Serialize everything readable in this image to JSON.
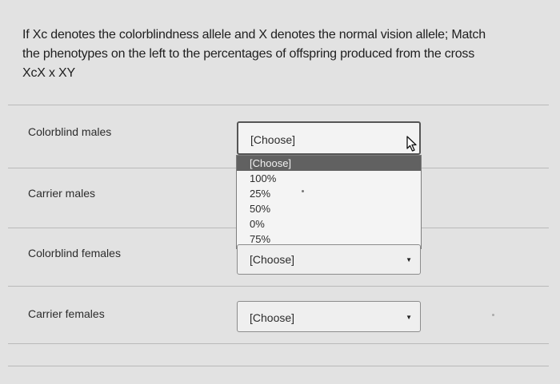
{
  "question": {
    "lines": [
      "If Xc denotes the colorblindness allele and X denotes the normal vision allele; Match",
      "the phenotypes on the left to the percentages of offspring produced from the cross",
      "XcX x XY"
    ]
  },
  "rows": [
    {
      "label": "Colorblind males",
      "selected": "[Choose]"
    },
    {
      "label": "Carrier males",
      "selected": "[Choose]"
    },
    {
      "label": "Colorblind females",
      "selected": "[Choose]"
    },
    {
      "label": "Carrier females",
      "selected": "[Choose]"
    }
  ],
  "dropdown": {
    "options": [
      "[Choose]",
      "100%",
      "25%",
      "50%",
      "0%",
      "75%"
    ],
    "highlighted_index": 0
  },
  "icons": {
    "select_arrow": "caret-down-icon",
    "cursor": "mouse-pointer-icon"
  }
}
